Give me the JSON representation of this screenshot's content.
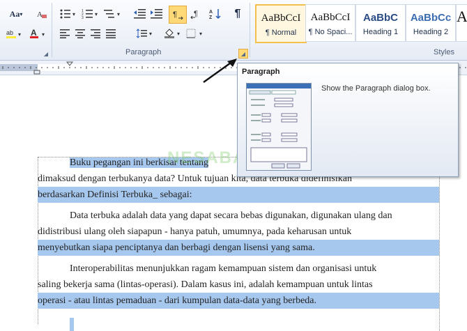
{
  "ribbon": {
    "font_group": {
      "grow_font_label": "Aa",
      "change_case_label": "Aa"
    },
    "paragraph_group": {
      "label": "Paragraph",
      "pilcrow": "¶"
    },
    "styles_group": {
      "label": "Styles",
      "items": [
        {
          "sample": "AaBbCcI",
          "name": "¶ Normal"
        },
        {
          "sample": "AaBbCcI",
          "name": "¶ No Spaci..."
        },
        {
          "sample": "AaBbC",
          "name": "Heading 1"
        },
        {
          "sample": "AaBbCc",
          "name": "Heading 2"
        },
        {
          "sample": "A",
          "name": ""
        }
      ]
    }
  },
  "tooltip": {
    "title": "Paragraph",
    "description": "Show the Paragraph dialog box."
  },
  "document": {
    "paragraphs": [
      {
        "lines": [
          "Buku pegangan ini berkisar tentang",
          "dimaksud dengan terbukanya data? Untuk tujuan kita, data terbuka didefinisikan",
          "berdasarkan Definisi Terbuka_ sebagai:"
        ]
      },
      {
        "lines": [
          "Data terbuka adalah data yang dapat secara bebas digunakan, digunakan ulang dan",
          "didistribusi ulang oleh siapapun - hanya patuh, umumnya, pada keharusan untuk",
          "menyebutkan siapa penciptanya dan berbagi dengan lisensi yang sama."
        ]
      },
      {
        "lines": [
          "Interoperabilitas menunjukkan ragam kemampuan sistem dan organisasi untuk",
          "saling bekerja sama (lintas-operasi). Dalam kasus ini, adalah kemampuan untuk lintas",
          "operasi - atau lintas pemaduan - dari kumpulan data-data yang berbeda."
        ]
      }
    ]
  },
  "watermark": "NESABAMEDIA",
  "colors": {
    "selection": "#a7c8ee",
    "ribbon_bg": "#e6ecf5",
    "accent": "#f3bf4f"
  }
}
